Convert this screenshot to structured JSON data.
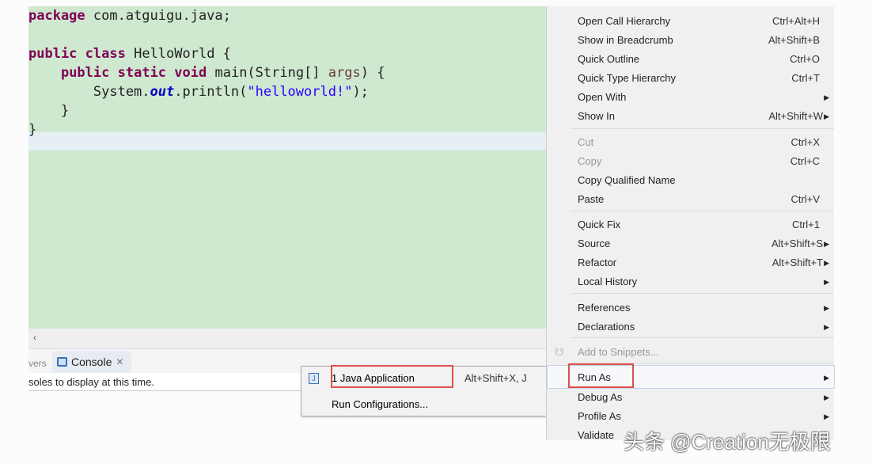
{
  "editor": {
    "lines": [
      {
        "parts": [
          {
            "t": "package",
            "c": "kw"
          },
          {
            "t": " com.atguigu.java;",
            "c": ""
          }
        ]
      },
      {
        "parts": []
      },
      {
        "parts": [
          {
            "t": "public",
            "c": "kw"
          },
          {
            "t": " ",
            "c": ""
          },
          {
            "t": "class",
            "c": "kw"
          },
          {
            "t": " HelloWorld {",
            "c": ""
          }
        ]
      },
      {
        "parts": [
          {
            "t": "    ",
            "c": ""
          },
          {
            "t": "public",
            "c": "kw"
          },
          {
            "t": " ",
            "c": ""
          },
          {
            "t": "static",
            "c": "kw"
          },
          {
            "t": " ",
            "c": ""
          },
          {
            "t": "void",
            "c": "kw"
          },
          {
            "t": " main(String[] ",
            "c": ""
          },
          {
            "t": "args",
            "c": "var"
          },
          {
            "t": ") {",
            "c": ""
          }
        ]
      },
      {
        "parts": [
          {
            "t": "        System.",
            "c": ""
          },
          {
            "t": "out",
            "c": "fld"
          },
          {
            "t": ".println(",
            "c": ""
          },
          {
            "t": "\"helloworld!\"",
            "c": "str"
          },
          {
            "t": ");",
            "c": ""
          }
        ]
      },
      {
        "parts": [
          {
            "t": "    }",
            "c": ""
          }
        ]
      },
      {
        "parts": [
          {
            "t": "}",
            "c": ""
          }
        ]
      }
    ]
  },
  "scroll_glyph": "‹",
  "bottom_panel": {
    "prev_tab": "vers",
    "console_tab": "Console",
    "close_glyph": "✕",
    "message": "soles to display at this time."
  },
  "submenu": {
    "items": [
      {
        "label": "1 Java Application",
        "shortcut": "Alt+Shift+X, J"
      },
      {
        "label": "Run Configurations..."
      }
    ]
  },
  "menu": {
    "items": [
      {
        "label": "Open Call Hierarchy",
        "shortcut": "Ctrl+Alt+H"
      },
      {
        "label": "Show in Breadcrumb",
        "shortcut": "Alt+Shift+B"
      },
      {
        "label": "Quick Outline",
        "shortcut": "Ctrl+O"
      },
      {
        "label": "Quick Type Hierarchy",
        "shortcut": "Ctrl+T"
      },
      {
        "label": "Open With",
        "arrow": true
      },
      {
        "label": "Show In",
        "shortcut": "Alt+Shift+W",
        "arrow": true
      },
      {
        "label": "Cut",
        "shortcut": "Ctrl+X",
        "disabled": true
      },
      {
        "label": "Copy",
        "shortcut": "Ctrl+C",
        "disabled": true
      },
      {
        "label": "Copy Qualified Name"
      },
      {
        "label": "Paste",
        "shortcut": "Ctrl+V"
      },
      {
        "label": "Quick Fix",
        "shortcut": "Ctrl+1"
      },
      {
        "label": "Source",
        "shortcut": "Alt+Shift+S",
        "arrow": true
      },
      {
        "label": "Refactor",
        "shortcut": "Alt+Shift+T",
        "arrow": true
      },
      {
        "label": "Local History",
        "arrow": true
      },
      {
        "label": "References",
        "arrow": true
      },
      {
        "label": "Declarations",
        "arrow": true
      },
      {
        "label": "Add to Snippets...",
        "disabled": true
      },
      {
        "label": "Run As",
        "arrow": true
      },
      {
        "label": "Debug As",
        "arrow": true
      },
      {
        "label": "Profile As",
        "arrow": true
      },
      {
        "label": "Validate"
      }
    ]
  },
  "watermark": "头条 @Creation无极限",
  "colors": {
    "editor_bg": "#cfe8d0",
    "highlight_box": "#e0504a"
  }
}
